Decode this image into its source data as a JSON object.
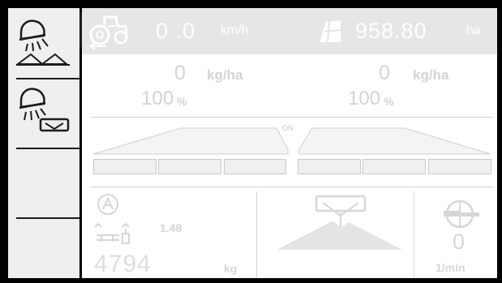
{
  "status": {
    "speed_value": "0 .0",
    "speed_unit": "km/h",
    "area_value": "958.80",
    "area_unit": "ha",
    "tractor_icon": "tractor-icon",
    "area_icon": "field-area-icon"
  },
  "dosing": {
    "left": {
      "rate": "0",
      "rate_unit": "kg/ha",
      "percent": "100",
      "percent_unit": "%"
    },
    "right": {
      "rate": "0",
      "rate_unit": "kg/ha",
      "percent": "100",
      "percent_unit": "%"
    },
    "on_label": "ON"
  },
  "sections": {
    "left": [
      "section-1",
      "section-2",
      "section-3"
    ],
    "right": [
      "section-4",
      "section-5",
      "section-6"
    ]
  },
  "bottom": {
    "calibration_value": "1.48",
    "weight_value": "4794",
    "weight_unit": "kg",
    "pto_value": "0",
    "pto_unit": "1/min"
  },
  "softkeys": [
    {
      "name": "spread-light-field-icon"
    },
    {
      "name": "spread-light-hopper-icon"
    },
    {
      "name": "empty-softkey"
    },
    {
      "name": "empty-softkey"
    }
  ],
  "colors": {
    "background": "#000000",
    "panel": "#ececec",
    "statusbar": "#e6e6e6",
    "inactive_text": "#d3d3d3",
    "separator": "#1b1b1b"
  }
}
